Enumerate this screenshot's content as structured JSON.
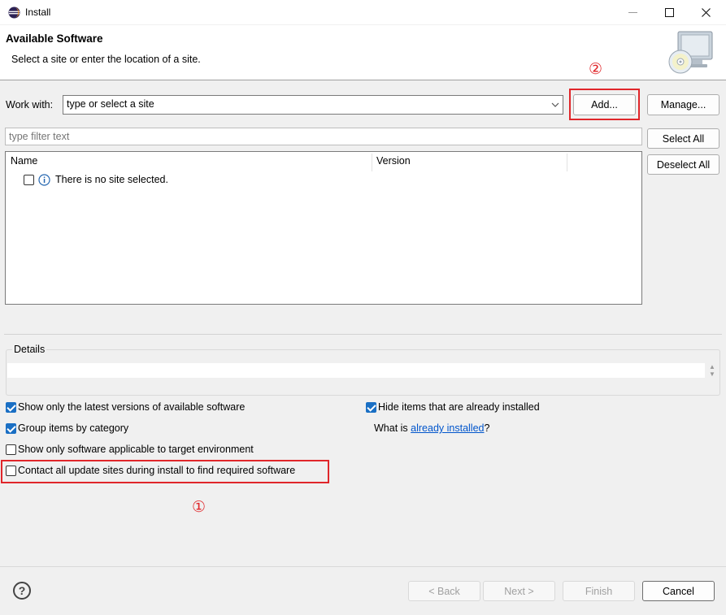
{
  "window": {
    "title": "Install",
    "min_icon": "minimize-icon",
    "max_icon": "maximize-icon",
    "close_icon": "close-icon"
  },
  "header": {
    "title": "Available Software",
    "description": "Select a site or enter the location of a site."
  },
  "work_with": {
    "label": "Work with:",
    "value": "type or select a site",
    "add_label": "Add...",
    "manage_label": "Manage..."
  },
  "filter": {
    "placeholder": "type filter text",
    "select_all": "Select All",
    "deselect_all": "Deselect All"
  },
  "tree": {
    "columns": [
      "Name",
      "Version"
    ],
    "rows": [
      {
        "text": "There is no site selected.",
        "checked": false
      }
    ]
  },
  "details": {
    "label": "Details"
  },
  "options": {
    "latest_versions": "Show only the latest versions of available software",
    "group_by_category": "Group items by category",
    "target_env": "Show only software applicable to target environment",
    "contact_all": "Contact all update sites during install to find required software",
    "hide_installed": "Hide items that are already installed",
    "what_is_prefix": "What is ",
    "what_is_link": "already installed",
    "what_is_suffix": "?"
  },
  "annotations": {
    "mark_1": "①",
    "mark_2": "②",
    "color": "#e0262a"
  },
  "footer": {
    "back": "< Back",
    "next": "Next >",
    "finish": "Finish",
    "cancel": "Cancel",
    "help": "?"
  },
  "colors": {
    "checkbox_checked": "#1a6fc4",
    "link": "#0055cc"
  }
}
